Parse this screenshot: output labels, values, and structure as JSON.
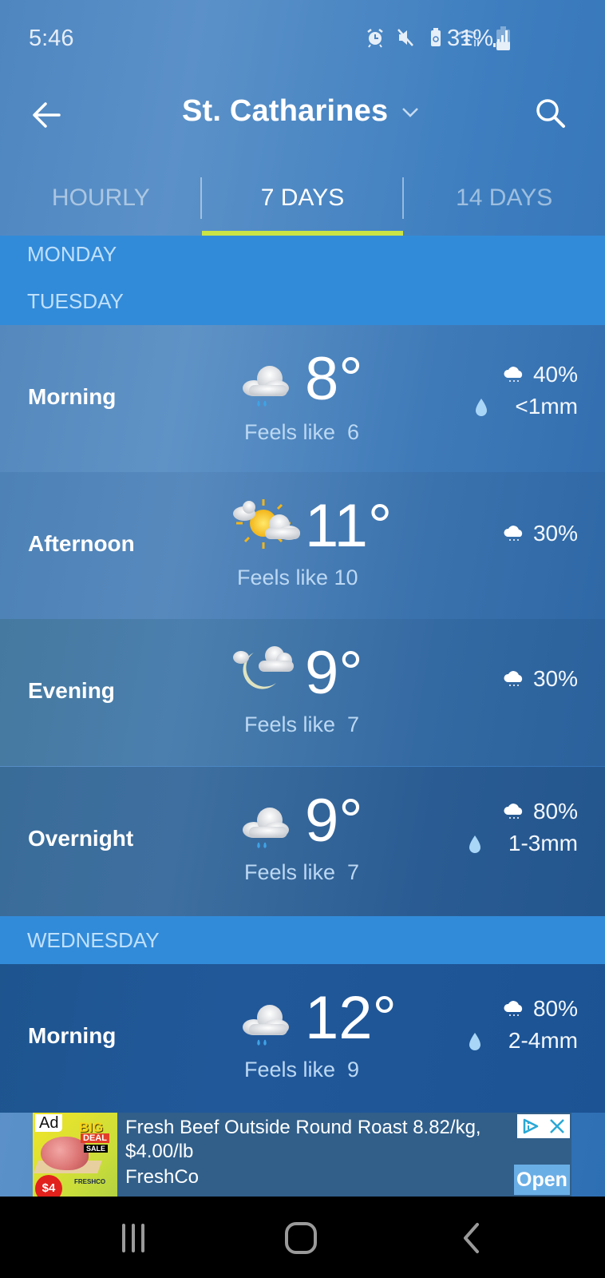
{
  "status_bar": {
    "time": "5:46",
    "battery_percent": "31%",
    "battery_level": 0.31,
    "icons": [
      "alarm-icon",
      "mute-icon",
      "battery-saver-icon",
      "wifi-icon",
      "signal-icon",
      "battery-icon"
    ]
  },
  "header": {
    "back_icon": "arrow-left-icon",
    "title": "St. Catharines",
    "dropdown_icon": "chevron-down-icon",
    "search_icon": "search-icon"
  },
  "tabs": [
    {
      "label": "HOURLY",
      "active": false
    },
    {
      "label": "7 DAYS",
      "active": true
    },
    {
      "label": "14 DAYS",
      "active": false
    }
  ],
  "colors": {
    "accent_underline": "#cbe445",
    "day_header_bg": "#328bd9",
    "day_header_text": "#bfe0fb",
    "feels_like_text": "#bcd8f3"
  },
  "days": [
    {
      "name": "MONDAY",
      "periods": []
    },
    {
      "name": "TUESDAY",
      "periods": [
        {
          "label": "Morning",
          "icon": "cloud-rain-icon",
          "temp": "8°",
          "feels_like": "Feels like  6",
          "pop": "40%",
          "precip": "<1mm"
        },
        {
          "label": "Afternoon",
          "icon": "partly-sunny-icon",
          "temp": "11°",
          "feels_like": "Feels like 10",
          "pop": "30%",
          "precip": null
        },
        {
          "label": "Evening",
          "icon": "partly-cloudy-night-icon",
          "temp": "9°",
          "feels_like": "Feels like  7",
          "pop": "30%",
          "precip": null
        },
        {
          "label": "Overnight",
          "icon": "cloud-rain-icon",
          "temp": "9°",
          "feels_like": "Feels like  7",
          "pop": "80%",
          "precip": "1-3mm"
        }
      ]
    },
    {
      "name": "WEDNESDAY",
      "periods": [
        {
          "label": "Morning",
          "icon": "cloud-rain-icon",
          "temp": "12°",
          "feels_like": "Feels like  9",
          "pop": "80%",
          "precip": "2-4mm"
        }
      ]
    }
  ],
  "ad": {
    "badge": "Ad",
    "image_text_big": "BIG",
    "image_text_deal": "DEAL",
    "image_text_sale": "SALE",
    "image_price": "$4",
    "image_brand": "FRESHCO",
    "title": "Fresh Beef Outside Round Roast 8.82/kg, $4.00/lb",
    "advertiser": "FreshCo",
    "open_label": "Open",
    "adchoices_icon": "adchoices-icon",
    "close_icon": "close-icon"
  },
  "nav_bar": {
    "recents_icon": "recent-apps-icon",
    "home_icon": "home-icon",
    "back_icon": "back-icon"
  }
}
